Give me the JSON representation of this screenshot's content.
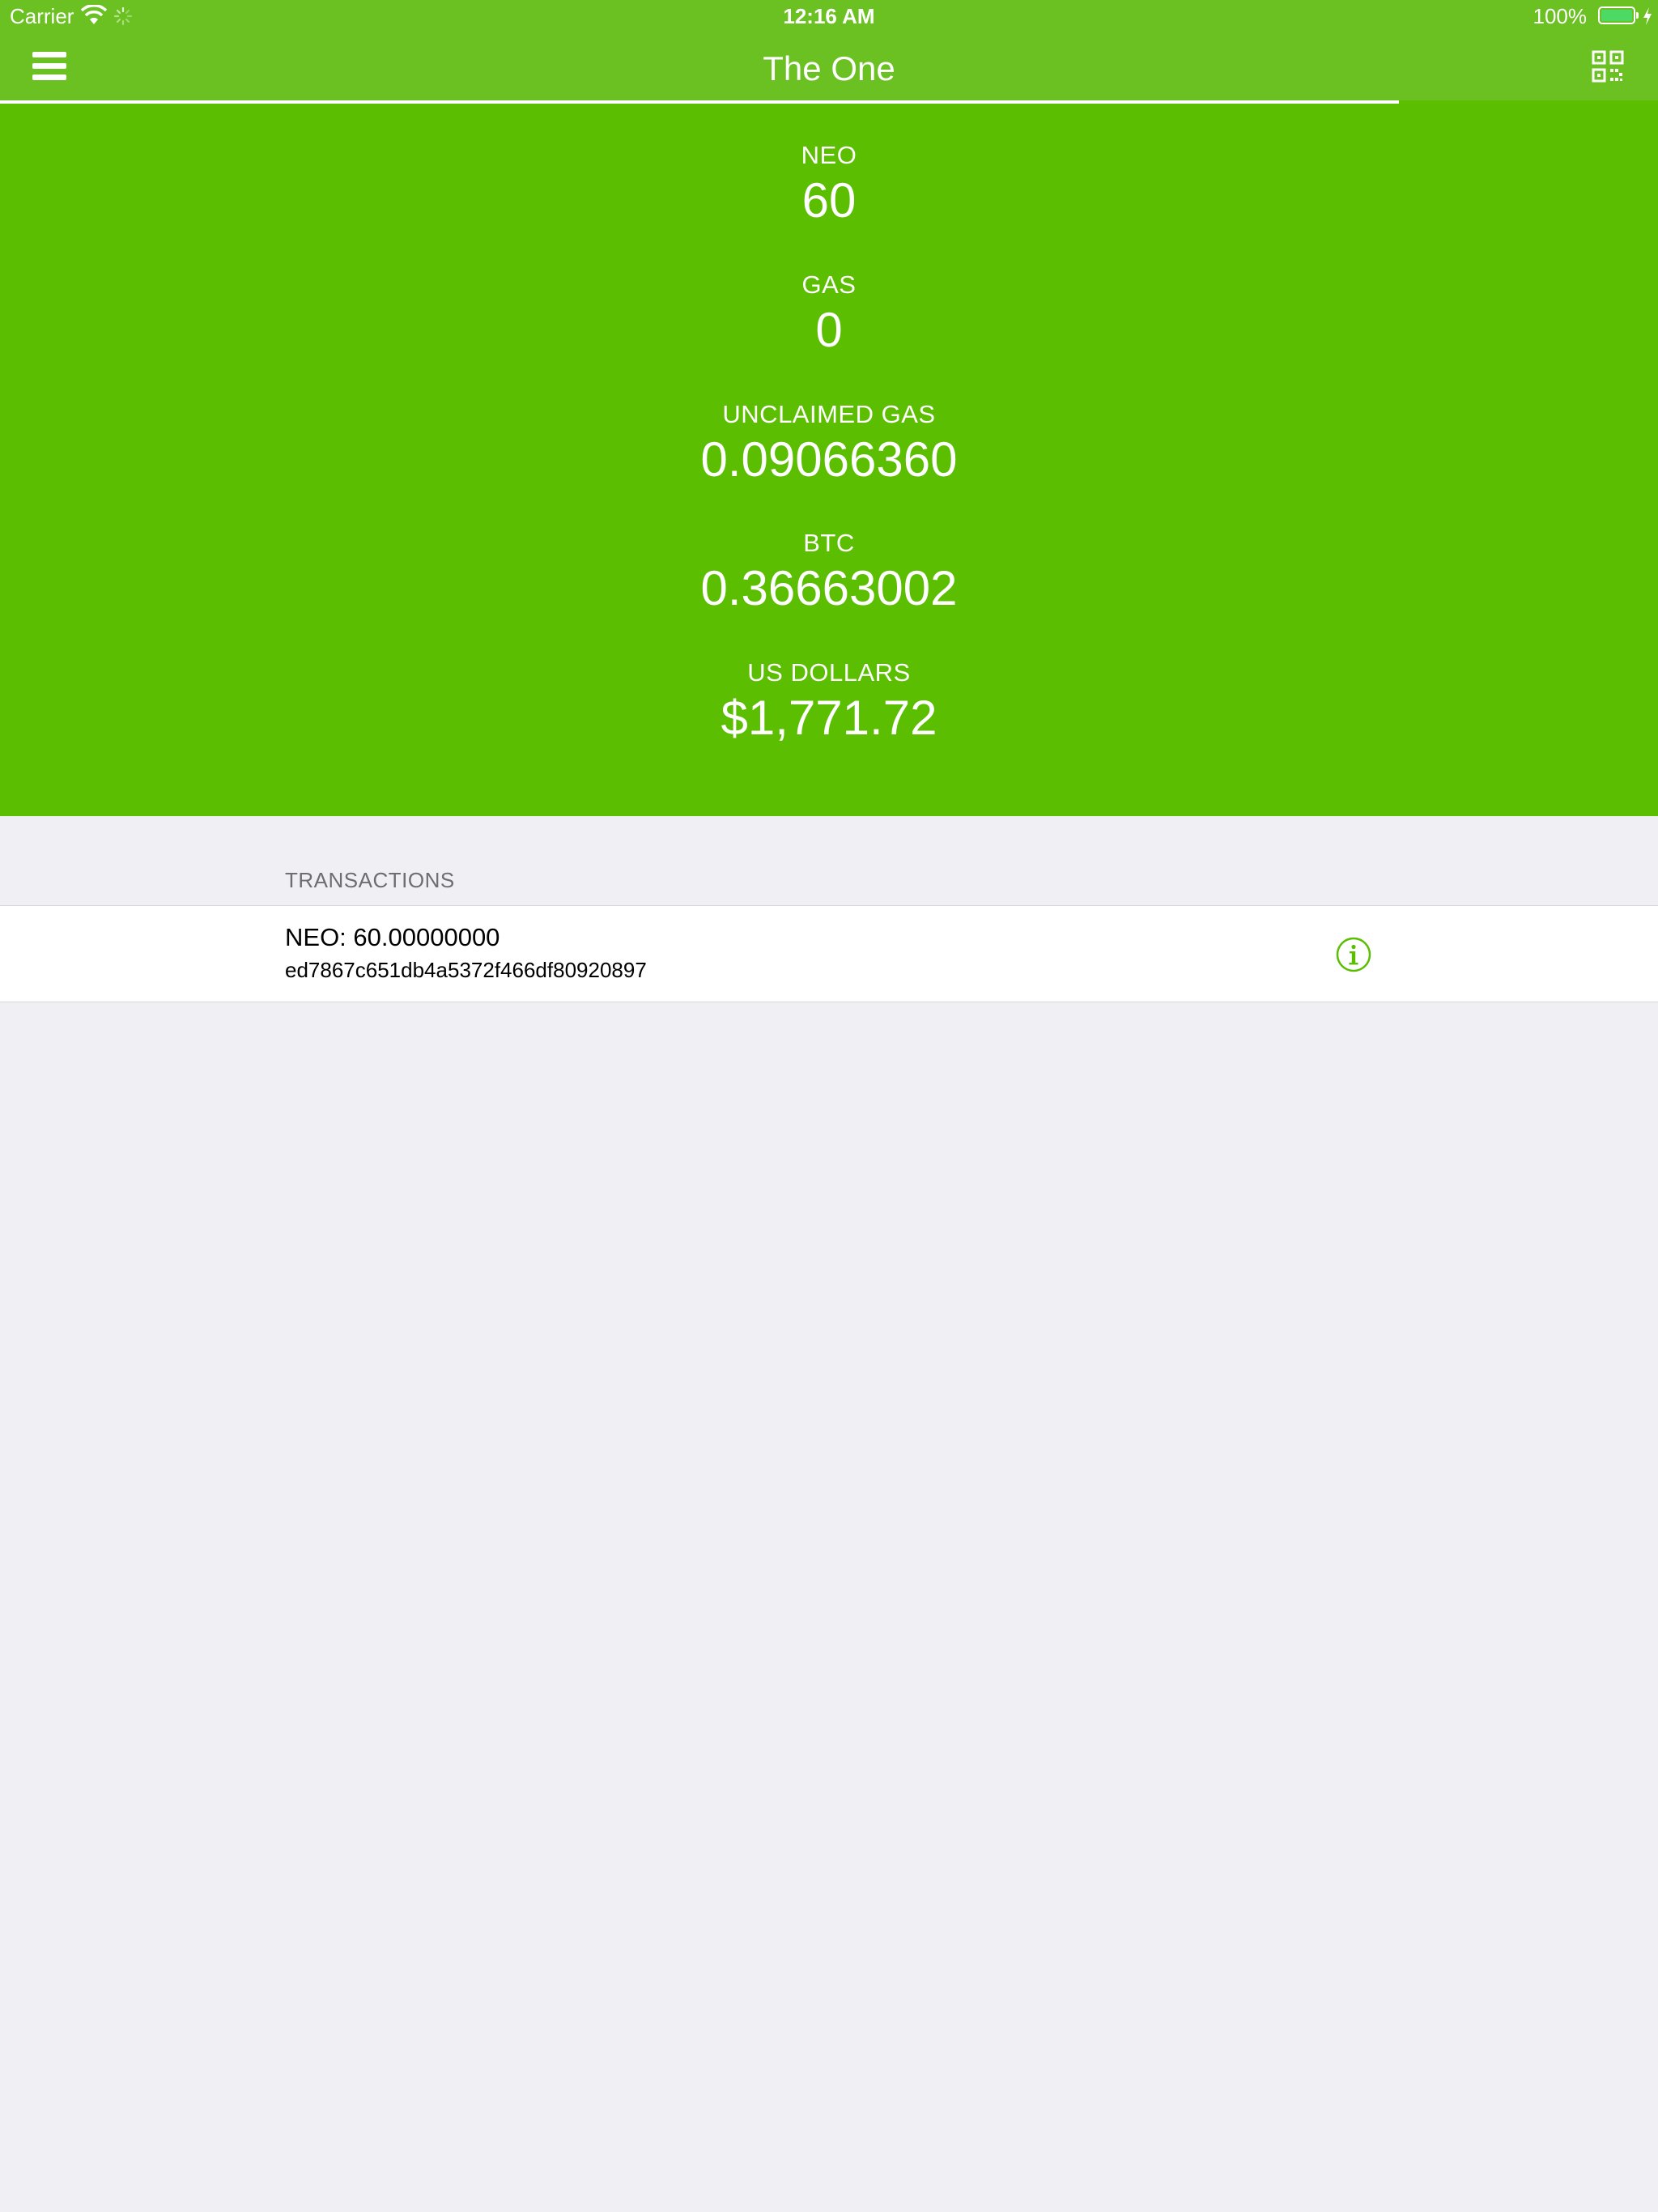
{
  "status_bar": {
    "carrier": "Carrier",
    "time": "12:16 AM",
    "battery": "100%",
    "icons": [
      "wifi-icon",
      "activity-spinner-icon",
      "battery-icon",
      "charging-bolt-icon"
    ]
  },
  "nav": {
    "title": "The One",
    "left_icon": "hamburger-menu-icon",
    "right_icon": "qr-code-icon"
  },
  "balances": [
    {
      "label": "NEO",
      "value": "60"
    },
    {
      "label": "GAS",
      "value": "0"
    },
    {
      "label": "UNCLAIMED GAS",
      "value": "0.09066360"
    },
    {
      "label": "BTC",
      "value": "0.36663002"
    },
    {
      "label": "US DOLLARS",
      "value": "$1,771.72"
    }
  ],
  "transactions": {
    "header": "TRANSACTIONS",
    "items": [
      {
        "amount": "NEO: 60.00000000",
        "hash": "ed7867c651db4a5372f466df80920897",
        "icon": "info-icon"
      }
    ]
  },
  "colors": {
    "header_green": "#6AC121",
    "balance_green": "#5BBE00",
    "background": "#EFEFF4",
    "accent": "#5BBE00"
  }
}
